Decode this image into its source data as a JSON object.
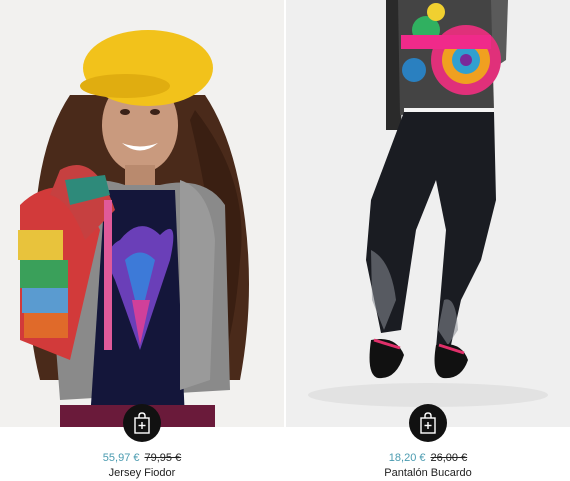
{
  "products": [
    {
      "name": "Jersey Fiodor",
      "price": "55,97 €",
      "old_price": "79,95 €",
      "image_desc_icon": "girl-in-yellow-beret-photo",
      "cart_icon": "shopping-bag-add-icon"
    },
    {
      "name": "Pantalón Bucardo",
      "price": "18,20 €",
      "old_price": "26,00 €",
      "image_desc_icon": "black-leggings-photo",
      "cart_icon": "shopping-bag-add-icon"
    }
  ],
  "colors": {
    "sale_price": "#4a9bb0",
    "button": "#111111"
  }
}
